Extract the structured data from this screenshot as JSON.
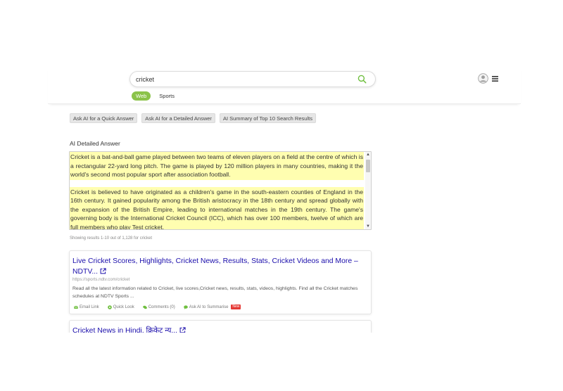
{
  "search": {
    "query": "cricket"
  },
  "tabs": [
    {
      "label": "Web",
      "active": true
    },
    {
      "label": "Sports",
      "active": false
    }
  ],
  "ai_buttons": [
    {
      "label": "Ask AI for a Quick Answer"
    },
    {
      "label": "Ask AI for a Detailed Answer"
    },
    {
      "label": "AI Summary of Top 10 Search Results"
    }
  ],
  "ai_answer": {
    "title": "AI Detailed Answer",
    "paragraphs": [
      "Cricket is a bat-and-ball game played between two teams of eleven players on a field at the centre of which is a rectangular 22-yard long pitch. The game is played by 120 million players in many countries, making it the world's second most popular sport after association football.",
      "Cricket is believed to have originated as a children's game in the south-eastern counties of England in the 16th century. It gained popularity among the British aristocracy in the 18th century and spread globally with the expansion of the British Empire, leading to international matches in the 19th century. The game's governing body is the International Cricket Council (ICC), which has over 100 members, twelve of which are full members who play Test cricket."
    ]
  },
  "results_info": "Showing results 1-10 out of 1,128 for cricket",
  "results": [
    {
      "title": "Live Cricket Scores, Highlights, Cricket News, Results, Stats, Cricket Videos and More – NDTV...",
      "url": "https://sports.ndtv.com/cricket",
      "description": "Read all the latest information related to Cricket, live scores,Cricket news, results, stats, videos, highlights. Find all the Cricket matches schedules at NDTV Sports ...",
      "actions": {
        "email": "Email Link",
        "quick": "Quick Look",
        "comments": "Comments (0)",
        "summarise": "Ask AI to Summarise",
        "badge": "New"
      }
    },
    {
      "title": "Cricket News in Hindi, क्रिकेट न्यू..."
    }
  ],
  "colors": {
    "accent": "#8bc34a",
    "link": "#1a0dab",
    "highlight": "#fffeb0",
    "badge": "#e53935"
  }
}
